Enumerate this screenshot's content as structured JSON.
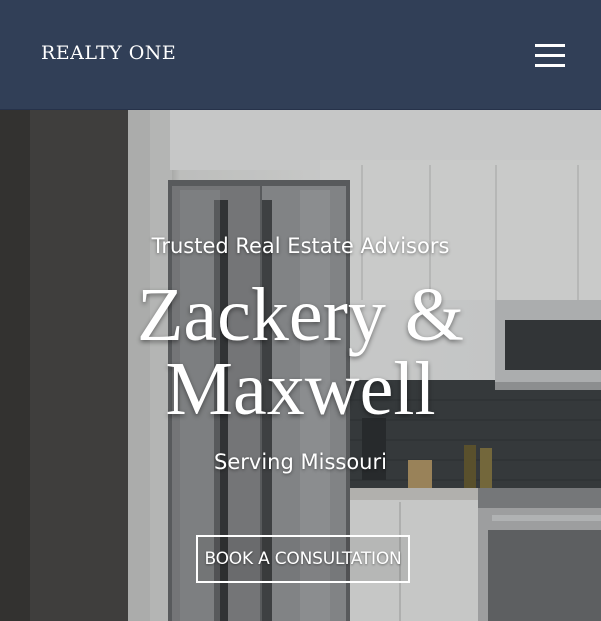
{
  "header": {
    "brand": "REALTY ONE",
    "menu_icon": "hamburger-menu-icon"
  },
  "hero": {
    "tagline": "Trusted Real Estate Advisors",
    "headline_line1": "Zackery &",
    "headline_line2": "Maxwell",
    "service_area": "Serving Missouri",
    "cta_label": "BOOK A CONSULTATION"
  },
  "colors": {
    "header_bg": "#313f57",
    "text": "#ffffff"
  }
}
